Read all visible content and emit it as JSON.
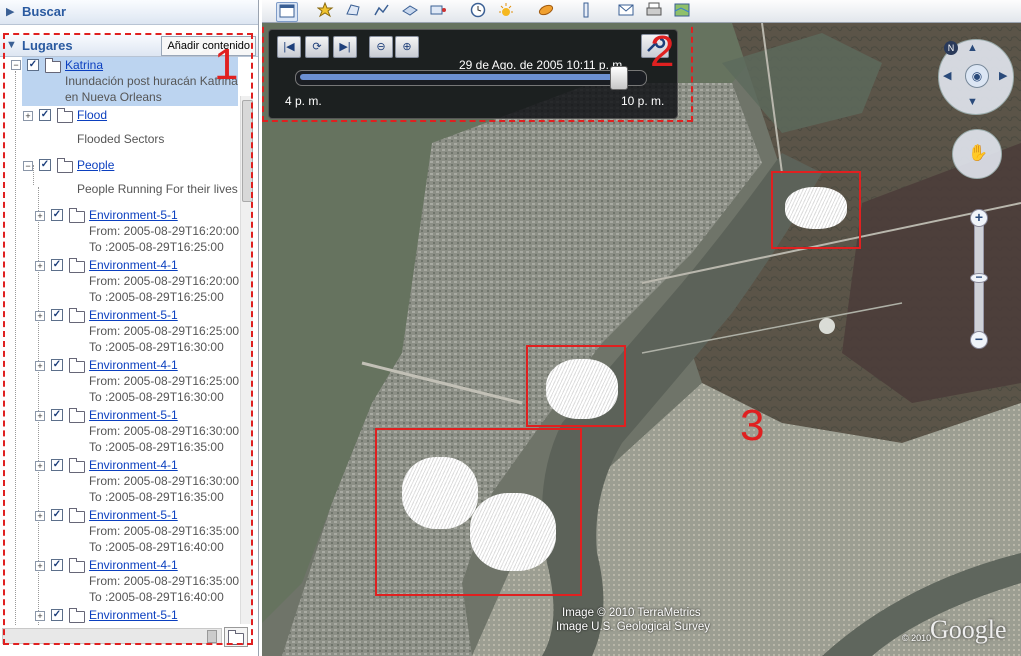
{
  "search": {
    "label": "Buscar"
  },
  "places": {
    "label": "Lugares",
    "add_button": "Añadir contenido",
    "root": {
      "name": "Katrina",
      "desc_line1": "Inundación post huracán Katrina",
      "desc_line2": "en Nueva Orleans"
    },
    "flood": {
      "name": "Flood",
      "desc": "Flooded Sectors"
    },
    "people": {
      "name": "People",
      "desc": "People Running For their lives"
    },
    "items": [
      {
        "name": "Environment-5-1",
        "from": "From: 2005-08-29T16:20:00",
        "to": "To :2005-08-29T16:25:00"
      },
      {
        "name": "Environment-4-1",
        "from": "From: 2005-08-29T16:20:00",
        "to": "To :2005-08-29T16:25:00"
      },
      {
        "name": "Environment-5-1",
        "from": "From: 2005-08-29T16:25:00",
        "to": "To :2005-08-29T16:30:00"
      },
      {
        "name": "Environment-4-1",
        "from": "From: 2005-08-29T16:25:00",
        "to": "To :2005-08-29T16:30:00"
      },
      {
        "name": "Environment-5-1",
        "from": "From: 2005-08-29T16:30:00",
        "to": "To :2005-08-29T16:35:00"
      },
      {
        "name": "Environment-4-1",
        "from": "From: 2005-08-29T16:30:00",
        "to": "To :2005-08-29T16:35:00"
      },
      {
        "name": "Environment-5-1",
        "from": "From: 2005-08-29T16:35:00",
        "to": "To :2005-08-29T16:40:00"
      },
      {
        "name": "Environment-4-1",
        "from": "From: 2005-08-29T16:35:00",
        "to": "To :2005-08-29T16:40:00"
      },
      {
        "name": "Environment-5-1"
      }
    ]
  },
  "time_slider": {
    "date": "29 de Ago. de 2005  10:11 p. m.",
    "start": "4 p. m.",
    "end": "10 p. m.",
    "position": 0.93
  },
  "annotations": {
    "one": "1",
    "two": "2",
    "three": "3"
  },
  "map": {
    "attribution_1": "Image © 2010 TerraMetrics",
    "attribution_2": "Image U.S. Geological Survey",
    "attribution_3": "© 2010",
    "logo": "Google"
  },
  "icons": {
    "toolbar": [
      "sidebar-icon",
      "placemark-icon",
      "polygon-icon",
      "path-icon",
      "overlay-icon",
      "tour-icon",
      "clock-icon",
      "sun-icon",
      "planet-icon",
      "ruler-icon",
      "email-icon",
      "print-icon",
      "map-view-icon"
    ],
    "map": [
      "compass-icon",
      "north-icon",
      "look-icon",
      "move-icon",
      "zoom-in-icon",
      "zoom-out-icon"
    ]
  },
  "colors": {
    "annotation_red": "#e02020",
    "link_blue": "#0b3fbf",
    "selected_bg": "#bcd4f0"
  }
}
